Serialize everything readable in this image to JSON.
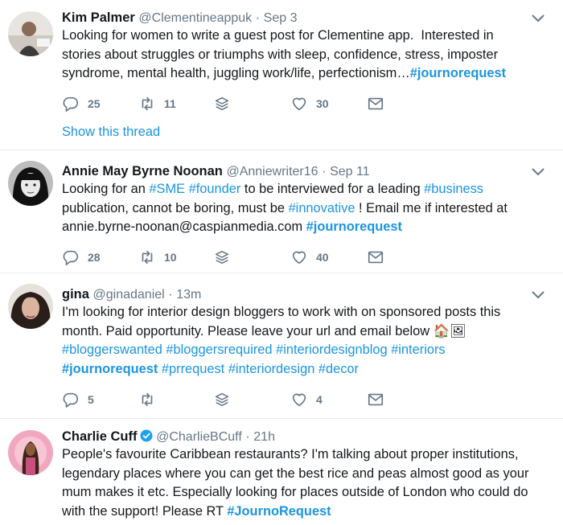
{
  "colors": {
    "link": "#1b95e0",
    "secondary": "#657786",
    "text": "#14171a",
    "divider": "#e6ecf0",
    "verified": "#1da1f2"
  },
  "tweets": [
    {
      "name": "Kim Palmer",
      "handle": "@Clementineappuk",
      "sep": "·",
      "time": "Sep 3",
      "text_lines": [
        [
          {
            "t": "Looking for women to write a guest post for Clementine app.  Interested in"
          }
        ],
        [
          {
            "t": "stories about struggles or triumphs with sleep, confidence, stress, imposter"
          }
        ],
        [
          {
            "t": "syndrome, mental health, juggling work/life, perfectionism…"
          },
          {
            "t": "#journorequest",
            "tag": "strong"
          }
        ]
      ],
      "reply_count": "25",
      "retweet_count": "11",
      "like_count": "30",
      "show_thread": "Show this thread"
    },
    {
      "name": "Annie May Byrne Noonan",
      "handle": "@Anniewriter16",
      "sep": "·",
      "time": "Sep 11",
      "text_lines": [
        [
          {
            "t": "Looking for an "
          },
          {
            "t": "#SME",
            "tag": "normal"
          },
          {
            "t": " "
          },
          {
            "t": "#founder",
            "tag": "normal"
          },
          {
            "t": " to be interviewed for a leading "
          },
          {
            "t": "#business",
            "tag": "normal"
          }
        ],
        [
          {
            "t": "publication, cannot be boring, must be "
          },
          {
            "t": "#innovative",
            "tag": "normal"
          },
          {
            "t": " ! Email me if interested at"
          }
        ],
        [
          {
            "t": "annie.byrne-noonan@caspianmedia.com "
          },
          {
            "t": "#journorequest",
            "tag": "strong"
          }
        ]
      ],
      "reply_count": "28",
      "retweet_count": "10",
      "like_count": "40"
    },
    {
      "name": "gina",
      "handle": "@ginadaniel",
      "sep": "·",
      "time": "13m",
      "text_lines": [
        [
          {
            "t": "I'm looking for interior design bloggers to work with on sponsored posts this"
          }
        ],
        [
          {
            "t": "month. Paid opportunity. Please leave your url and email below "
          },
          {
            "t": "🏠🖼",
            "tag": "emoji"
          }
        ],
        [
          {
            "t": "#bloggerswanted",
            "tag": "normal"
          },
          {
            "t": " "
          },
          {
            "t": "#bloggersrequired",
            "tag": "normal"
          },
          {
            "t": " "
          },
          {
            "t": "#interiordesignblog",
            "tag": "normal"
          },
          {
            "t": " "
          },
          {
            "t": "#interiors",
            "tag": "normal"
          }
        ],
        [
          {
            "t": "#journorequest",
            "tag": "strong"
          },
          {
            "t": " "
          },
          {
            "t": "#prrequest",
            "tag": "normal"
          },
          {
            "t": " "
          },
          {
            "t": "#interiordesign",
            "tag": "normal"
          },
          {
            "t": " "
          },
          {
            "t": "#decor",
            "tag": "normal"
          }
        ]
      ],
      "reply_count": "5",
      "retweet_count": "",
      "like_count": "4"
    },
    {
      "name": "Charlie Cuff",
      "verified": true,
      "handle": "@CharlieBCuff",
      "sep": "·",
      "time": "21h",
      "text_lines": [
        [
          {
            "t": "People's favourite Caribbean restaurants? I'm talking about proper institutions,"
          }
        ],
        [
          {
            "t": "legendary places where you can get the best rice and peas almost good as your"
          }
        ],
        [
          {
            "t": "mum makes it etc. Especially looking for places outside of London who could do"
          }
        ],
        [
          {
            "t": "with the support! Please RT "
          },
          {
            "t": "#JournoRequest",
            "tag": "strong"
          }
        ]
      ]
    }
  ]
}
